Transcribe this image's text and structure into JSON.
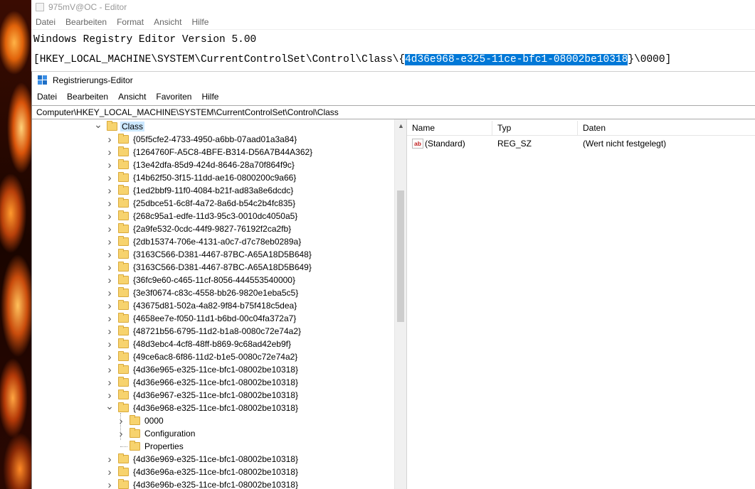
{
  "notepad": {
    "title": "975mV@OC - Editor",
    "menu": [
      "Datei",
      "Bearbeiten",
      "Format",
      "Ansicht",
      "Hilfe"
    ],
    "line1": "Windows Registry Editor Version 5.00",
    "line2_prefix": "[HKEY_LOCAL_MACHINE\\SYSTEM\\CurrentControlSet\\Control\\Class\\{",
    "line2_selected": "4d36e968-e325-11ce-bfc1-08002be10318",
    "line2_suffix": "}\\0000]"
  },
  "regedit": {
    "title": "Registrierungs-Editor",
    "menu": [
      "Datei",
      "Bearbeiten",
      "Ansicht",
      "Favoriten",
      "Hilfe"
    ],
    "address": "Computer\\HKEY_LOCAL_MACHINE\\SYSTEM\\CurrentControlSet\\Control\\Class",
    "tree": {
      "root": {
        "label": "Class",
        "expanded": true
      },
      "items": [
        {
          "label": "{05f5cfe2-4733-4950-a6bb-07aad01a3a84}"
        },
        {
          "label": "{1264760F-A5C8-4BFE-B314-D56A7B44A362}"
        },
        {
          "label": "{13e42dfa-85d9-424d-8646-28a70f864f9c}"
        },
        {
          "label": "{14b62f50-3f15-11dd-ae16-0800200c9a66}"
        },
        {
          "label": "{1ed2bbf9-11f0-4084-b21f-ad83a8e6dcdc}"
        },
        {
          "label": "{25dbce51-6c8f-4a72-8a6d-b54c2b4fc835}"
        },
        {
          "label": "{268c95a1-edfe-11d3-95c3-0010dc4050a5}"
        },
        {
          "label": "{2a9fe532-0cdc-44f9-9827-76192f2ca2fb}"
        },
        {
          "label": "{2db15374-706e-4131-a0c7-d7c78eb0289a}"
        },
        {
          "label": "{3163C566-D381-4467-87BC-A65A18D5B648}"
        },
        {
          "label": "{3163C566-D381-4467-87BC-A65A18D5B649}"
        },
        {
          "label": "{36fc9e60-c465-11cf-8056-444553540000}"
        },
        {
          "label": "{3e3f0674-c83c-4558-bb26-9820e1eba5c5}"
        },
        {
          "label": "{43675d81-502a-4a82-9f84-b75f418c5dea}"
        },
        {
          "label": "{4658ee7e-f050-11d1-b6bd-00c04fa372a7}"
        },
        {
          "label": "{48721b56-6795-11d2-b1a8-0080c72e74a2}"
        },
        {
          "label": "{48d3ebc4-4cf8-48ff-b869-9c68ad42eb9f}"
        },
        {
          "label": "{49ce6ac8-6f86-11d2-b1e5-0080c72e74a2}"
        },
        {
          "label": "{4d36e965-e325-11ce-bfc1-08002be10318}"
        },
        {
          "label": "{4d36e966-e325-11ce-bfc1-08002be10318}"
        },
        {
          "label": "{4d36e967-e325-11ce-bfc1-08002be10318}"
        },
        {
          "label": "{4d36e968-e325-11ce-bfc1-08002be10318}",
          "expanded": true,
          "children": [
            {
              "label": "0000",
              "has_children": true
            },
            {
              "label": "Configuration",
              "has_children": true
            },
            {
              "label": "Properties",
              "has_children": false
            }
          ]
        },
        {
          "label": "{4d36e969-e325-11ce-bfc1-08002be10318}"
        },
        {
          "label": "{4d36e96a-e325-11ce-bfc1-08002be10318}"
        },
        {
          "label": "{4d36e96b-e325-11ce-bfc1-08002be10318}"
        }
      ]
    },
    "list": {
      "columns": [
        "Name",
        "Typ",
        "Daten"
      ],
      "rows": [
        {
          "icon": "string-value-icon",
          "icon_text": "ab",
          "name": "(Standard)",
          "type": "REG_SZ",
          "data": "(Wert nicht festgelegt)"
        }
      ]
    }
  },
  "colors": {
    "selection": "#0078d7",
    "folder": "#f7d36e",
    "tree_selected": "#cce8ff"
  }
}
